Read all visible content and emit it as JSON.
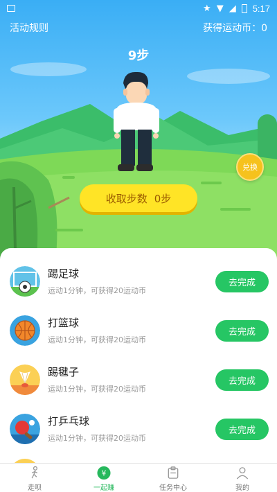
{
  "status_bar": {
    "time": "5:17"
  },
  "header": {
    "rules_label": "活动规则",
    "coins_label": "获得运动币：0"
  },
  "steps": {
    "title": "9步"
  },
  "exchange_label": "兑换",
  "collect": {
    "label": "收取步数",
    "value": "0步"
  },
  "tasks": [
    {
      "name": "踢足球",
      "desc": "运动1分钟，可获得20运动币",
      "button": "去完成",
      "icon": "soccer-icon"
    },
    {
      "name": "打篮球",
      "desc": "运动1分钟，可获得20运动币",
      "button": "去完成",
      "icon": "basketball-icon"
    },
    {
      "name": "踢毽子",
      "desc": "运动1分钟，可获得20运动币",
      "button": "去完成",
      "icon": "shuttlecock-icon"
    },
    {
      "name": "打乒乓球",
      "desc": "运动1分钟，可获得20运动币",
      "button": "去完成",
      "icon": "pingpong-icon"
    }
  ],
  "tabbar": {
    "items": [
      {
        "label": "走呗",
        "icon": "walking-icon"
      },
      {
        "label": "一起赚",
        "icon": "yen-coin-icon",
        "active": true,
        "icon_text": "¥"
      },
      {
        "label": "任务中心",
        "icon": "task-clipboard-icon"
      },
      {
        "label": "我的",
        "icon": "person-icon"
      }
    ]
  },
  "colors": {
    "accent_green": "#26c664",
    "collect_yellow": "#ffe426",
    "sky_blue": "#3aaef5"
  }
}
